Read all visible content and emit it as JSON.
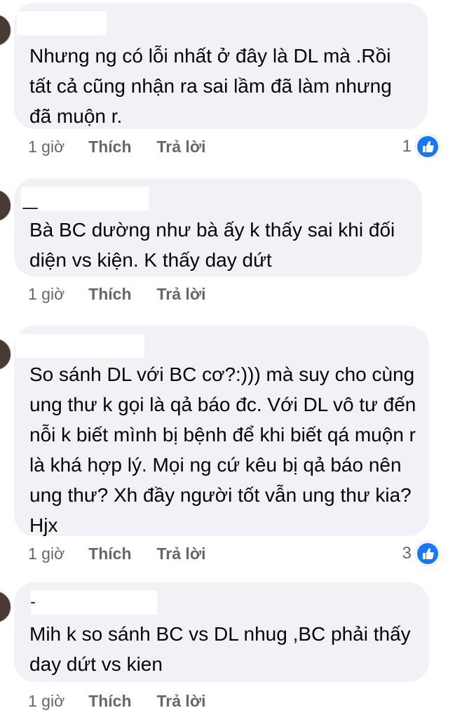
{
  "comments": [
    {
      "text": "Nhưng ng có lỗi nhất ở đây là DL mà .Rồi tất cả cũng nhận ra sai lầm đã làm nhưng đã muộn r.",
      "time": "1 giờ",
      "like_label": "Thích",
      "reply_label": "Trả lời",
      "reaction_count": "1",
      "reaction_icon": "like-icon"
    },
    {
      "text": "Bà BC dường như bà ấy k thấy sai khi đối diện vs kiện. K thấy day dứt",
      "time": "1 giờ",
      "like_label": "Thích",
      "reply_label": "Trả lời"
    },
    {
      "text": "So sánh DL với BC cơ?:))) mà suy cho cùng ung thư k gọi là qả báo đc. Với DL vô tư đến nỗi k biết mình bị bệnh để khi biết qá muộn r là khá hợp lý. Mọi ng cứ kêu bị qả báo nên ung thư? Xh đầy người tốt vẫn ung thư kia? Hjx",
      "time": "1 giờ",
      "like_label": "Thích",
      "reply_label": "Trả lời",
      "reaction_count": "3",
      "reaction_icon": "like-icon"
    },
    {
      "text": "Mih k so sánh BC vs DL nhug ,BC phải thấy day dứt vs kien",
      "time": "1 giờ",
      "like_label": "Thích",
      "reply_label": "Trả lời"
    }
  ],
  "colors": {
    "bubble": "#f0f2f5",
    "text": "#050505",
    "meta": "#65676b",
    "like_blue": "#1877f2"
  }
}
